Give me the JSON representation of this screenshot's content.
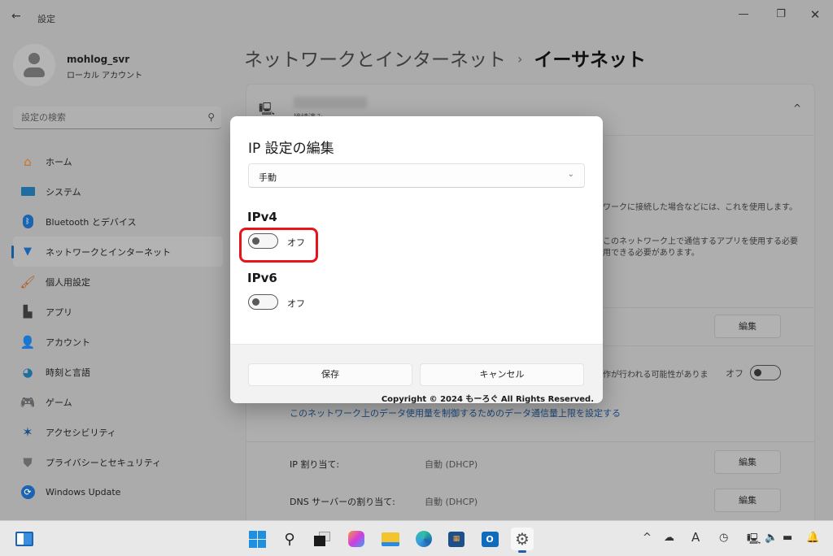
{
  "window": {
    "app_title": "設定",
    "back_icon": "arrow-left-icon",
    "controls": {
      "minimize": "—",
      "maximize": "❐",
      "close": "✕"
    }
  },
  "profile": {
    "name": "mohlog_svr",
    "account_type": "ローカル アカウント"
  },
  "search": {
    "placeholder": "設定の検索",
    "icon": "🔍"
  },
  "sidebar": {
    "items": [
      {
        "label": "ホーム",
        "icon": "home-icon",
        "glyph": "⌂",
        "color": "#c9742a"
      },
      {
        "label": "システム",
        "icon": "system-icon",
        "glyph": "▬",
        "color": "#1f6e9e"
      },
      {
        "label": "Bluetooth とデバイス",
        "icon": "bluetooth-icon",
        "glyph": "✱",
        "color": "#1a64b0"
      },
      {
        "label": "ネットワークとインターネット",
        "icon": "wifi-icon",
        "glyph": "◆",
        "color": "#1a64b0",
        "active": true
      },
      {
        "label": "個人用設定",
        "icon": "brush-icon",
        "glyph": "╱",
        "color": "#b05a1c"
      },
      {
        "label": "アプリ",
        "icon": "apps-icon",
        "glyph": "▙",
        "color": "#3a3a3a"
      },
      {
        "label": "アカウント",
        "icon": "account-icon",
        "glyph": "●",
        "color": "#1d7a5a"
      },
      {
        "label": "時刻と言語",
        "icon": "time-language-icon",
        "glyph": "◕",
        "color": "#1f6e9e"
      },
      {
        "label": "ゲーム",
        "icon": "gamepad-icon",
        "glyph": "⬬",
        "color": "#666666"
      },
      {
        "label": "アクセシビリティ",
        "icon": "accessibility-icon",
        "glyph": "✶",
        "color": "#1a4f8a"
      },
      {
        "label": "プライバシーとセキュリティ",
        "icon": "shield-icon",
        "glyph": "⛊",
        "color": "#6a6a6a"
      },
      {
        "label": "Windows Update",
        "icon": "update-icon",
        "glyph": "⟳",
        "color": "#1a64b0"
      }
    ]
  },
  "header": {
    "breadcrumb_parent": "ネットワークとインターネット",
    "separator": "›",
    "breadcrumb_current": "イーサネット"
  },
  "card": {
    "status": "接続済み",
    "collapse_glyph": "^",
    "text_line_1": "ワークに接続した場合などには、これを使用します。",
    "text_line_2a": "このネットワーク上で通信するアプリを使用する必要",
    "text_line_2b": "用できる必要があります。",
    "edit_label": "編集",
    "metered_text": "作が行われる可能性がありま",
    "metered_state": "オフ",
    "data_limit_link": "このネットワーク上のデータ使用量を制御するためのデータ通信量上限を設定する",
    "rows": [
      {
        "label": "IP 割り当て:",
        "value": "自動 (DHCP)",
        "button": "編集"
      },
      {
        "label": "DNS サーバーの割り当て:",
        "value": "自動 (DHCP)",
        "button": "編集"
      }
    ]
  },
  "dialog": {
    "title": "IP 設定の編集",
    "mode_select": {
      "value": "手動",
      "chevron": "⌄"
    },
    "ipv4": {
      "heading": "IPv4",
      "state_label": "オフ",
      "on": false
    },
    "ipv6": {
      "heading": "IPv6",
      "state_label": "オフ",
      "on": false
    },
    "save_label": "保存",
    "cancel_label": "キャンセル",
    "copyright": "Copyright © 2024 もーろぐ All Rights Reserved.",
    "highlight_color": "#e8141b"
  },
  "taskbar": {
    "widgets": "widgets-icon",
    "apps": [
      "start",
      "search",
      "task-view",
      "copilot",
      "file-explorer",
      "edge",
      "store",
      "outlook",
      "settings"
    ],
    "tray": [
      "chevron-up",
      "onedrive",
      "ime",
      "clock",
      "network",
      "volume",
      "battery",
      "notifications"
    ]
  }
}
